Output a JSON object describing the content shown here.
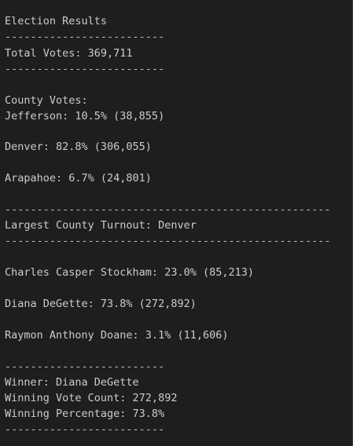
{
  "output": {
    "title": "Election Results",
    "separator_short": "-------------------------",
    "separator_long": "---------------------------------------------------",
    "total_votes": "Total Votes: 369,711",
    "county_votes_header": "County Votes:",
    "counties": [
      "Jefferson: 10.5% (38,855)",
      "Denver: 82.8% (306,055)",
      "Arapahoe: 6.7% (24,801)"
    ],
    "largest_county": "Largest County Turnout: Denver",
    "candidates": [
      "Charles Casper Stockham: 23.0% (85,213)",
      "Diana DeGette: 73.8% (272,892)",
      "Raymon Anthony Doane: 3.1% (11,606)"
    ],
    "winner": "Winner: Diana DeGette",
    "winning_vote_count": "Winning Vote Count: 272,892",
    "winning_percentage": "Winning Percentage: 73.8%"
  }
}
